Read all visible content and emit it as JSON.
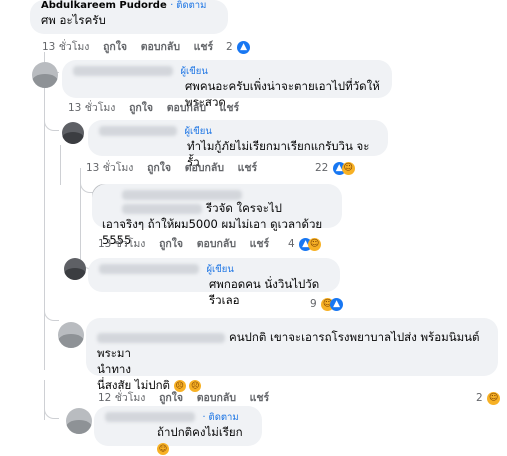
{
  "comments": [
    {
      "author_label": "Abdulkareem Pudorde",
      "follow": "· ติดตาม",
      "text": "ศพ อะไรครับ",
      "actions": {
        "time": "13 ชั่วโมง",
        "like": "ถูกใจ",
        "reply": "ตอบกลับ",
        "share": "แชร์"
      },
      "reaction_count": "2",
      "reaction_icons": [
        "like-icon"
      ]
    },
    {
      "role": "ผู้เขียน",
      "text": "ศพคนอะครับเพิ่งน่าจะตายเอาไปที่วัดให้พระสวด",
      "actions": {
        "time": "13 ชั่วโมง",
        "like": "ถูกใจ",
        "reply": "ตอบกลับ",
        "share": "แชร์"
      }
    },
    {
      "role": "ผู้เขียน",
      "text": "ทำไมกู้ภัยไม่เรียกมาเรียกแกรับวิน จะรั้ว",
      "actions": {
        "time": "13 ชั่วโมง",
        "like": "ถูกใจ",
        "reply": "ตอบกลับ",
        "share": "แชร์"
      },
      "reaction_count": "22",
      "reaction_icons": [
        "like-icon",
        "haha-icon"
      ]
    },
    {
      "text_line1": "รีวจัด ใครจะไป",
      "text_line2": "เอาจริงๆ ถ้าให้ผม5000 ผมไม่เอา ดูเวลาด้วย 5555",
      "actions": {
        "time": "13 ชั่วโมง",
        "like": "ถูกใจ",
        "reply": "ตอบกลับ",
        "share": "แชร์"
      },
      "reaction_count": "4",
      "reaction_icons": [
        "like-icon",
        "haha-icon"
      ]
    },
    {
      "role": "ผู้เขียน",
      "text": "ศพกอดคน นั่งวินไปวัด รีวเลอ",
      "actions": {
        "time": "13 ชั่วโมง",
        "like": "ถูกใจ",
        "reply": "ตอบกลับ",
        "share": "แชร์"
      },
      "reaction_count": "9",
      "reaction_icons": [
        "haha-icon",
        "like-icon"
      ]
    },
    {
      "text_line1": "คนปกติ เขาจะเอารถโรงพยาบาลไปส่ง พร้อมนิมนต์พระมา",
      "text_line2": "นำทาง",
      "text_line3": "นี่สงสัย ไม่ปกติ",
      "actions": {
        "time": "12 ชั่วโมง",
        "like": "ถูกใจ",
        "reply": "ตอบกลับ",
        "share": "แชร์"
      },
      "reaction_count": "2",
      "reaction_icons": [
        "haha-icon"
      ]
    },
    {
      "follow": "· ติดตาม",
      "text": "ถ้าปกติคงไม่เรียก"
    }
  ],
  "colors": {
    "accent": "#1b74e4",
    "bubble": "#f0f2f5",
    "muted": "#65676b"
  }
}
